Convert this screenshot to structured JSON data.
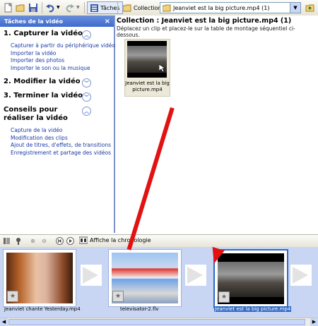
{
  "toolbar": {
    "tasks_label": "Tâches",
    "collections_label": "Collections",
    "collection_select": "Jeanviet est la big picture.mp4 (1)"
  },
  "tasks_pane": {
    "title": "Tâches de la vidéo",
    "close": "×",
    "sections": [
      {
        "title": "1. Capturer la vidéo",
        "links": [
          "Capturer à partir du périphérique vidéo",
          "Importer la vidéo",
          "Importer des photos",
          "Importer le son ou la musique"
        ]
      },
      {
        "title": "2. Modifier la vidéo",
        "links": []
      },
      {
        "title": "3. Terminer la vidéo",
        "links": []
      },
      {
        "title": "Conseils pour réaliser la vidéo",
        "links": [
          "Capture de la vidéo",
          "Modification des clips",
          "Ajout de titres, d'effets, de transitions",
          "Enregistrement et partage des vidéos"
        ]
      }
    ]
  },
  "collection": {
    "title": "Collection : Jeanviet est la big picture.mp4 (1)",
    "subtitle": "Déplacez un clip et placez-le sur la table de montage séquentiel ci-dessous.",
    "clips": [
      {
        "label": "Jeanviet est la big picture.mp4"
      }
    ]
  },
  "storyboard_bar": {
    "timeline_label": "Affiche la chronologie"
  },
  "storyboard": {
    "clips": [
      {
        "label": "Jeanviet chante Yesterday.mp4",
        "selected": false
      },
      {
        "label": "televisator-2.flv",
        "selected": false
      },
      {
        "label": "Jeanviet est la big picture.mp4",
        "selected": true
      }
    ]
  },
  "colors": {
    "accent": "#3169c6",
    "arrow": "#e21212",
    "storyboard_bg": "#c8d6f3"
  }
}
